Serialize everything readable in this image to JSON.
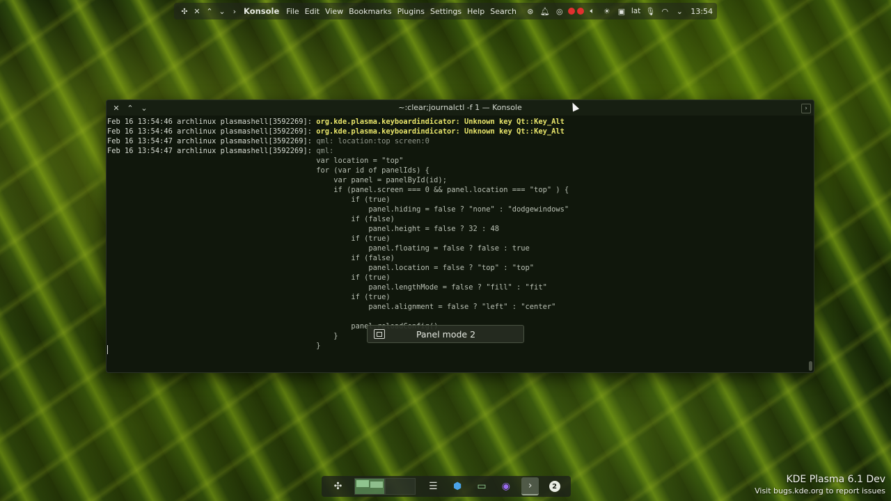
{
  "top_panel": {
    "app_name": "Konsole",
    "menu": [
      "File",
      "Edit",
      "View",
      "Bookmarks",
      "Plugins",
      "Settings",
      "Help",
      "Search"
    ],
    "keyboard_layout": "lat",
    "clock": "13:54"
  },
  "window": {
    "title": "~:clear;journalctl -f 1 — Konsole"
  },
  "terminal": {
    "lines": [
      {
        "prefix": "Feb 16 13:54:46 archlinux plasmashell[3592269]: ",
        "msg": "org.kde.plasma.keyboardindicator: Unknown key Qt::Key_Alt",
        "style": "warn"
      },
      {
        "prefix": "Feb 16 13:54:46 archlinux plasmashell[3592269]: ",
        "msg": "org.kde.plasma.keyboardindicator: Unknown key Qt::Key_Alt",
        "style": "warn"
      },
      {
        "prefix": "Feb 16 13:54:47 archlinux plasmashell[3592269]: ",
        "msg": "qml: location:top screen:0",
        "style": "muted"
      },
      {
        "prefix": "Feb 16 13:54:47 archlinux plasmashell[3592269]: ",
        "msg": "qml:",
        "style": "muted"
      },
      {
        "prefix": "",
        "msg": "                                                var location = \"top\"",
        "style": "code"
      },
      {
        "prefix": "",
        "msg": "                                                for (var id of panelIds) {",
        "style": "code"
      },
      {
        "prefix": "",
        "msg": "                                                    var panel = panelById(id);",
        "style": "code"
      },
      {
        "prefix": "",
        "msg": "                                                    if (panel.screen === 0 && panel.location === \"top\" ) {",
        "style": "code"
      },
      {
        "prefix": "",
        "msg": "                                                        if (true)",
        "style": "code"
      },
      {
        "prefix": "",
        "msg": "                                                            panel.hiding = false ? \"none\" : \"dodgewindows\"",
        "style": "code"
      },
      {
        "prefix": "",
        "msg": "                                                        if (false)",
        "style": "code"
      },
      {
        "prefix": "",
        "msg": "                                                            panel.height = false ? 32 : 48",
        "style": "code"
      },
      {
        "prefix": "",
        "msg": "                                                        if (true)",
        "style": "code"
      },
      {
        "prefix": "",
        "msg": "                                                            panel.floating = false ? false : true",
        "style": "code"
      },
      {
        "prefix": "",
        "msg": "                                                        if (false)",
        "style": "code"
      },
      {
        "prefix": "",
        "msg": "                                                            panel.location = false ? \"top\" : \"top\"",
        "style": "code"
      },
      {
        "prefix": "",
        "msg": "                                                        if (true)",
        "style": "code"
      },
      {
        "prefix": "",
        "msg": "                                                            panel.lengthMode = false ? \"fill\" : \"fit\"",
        "style": "code"
      },
      {
        "prefix": "",
        "msg": "                                                        if (true)",
        "style": "code"
      },
      {
        "prefix": "",
        "msg": "                                                            panel.alignment = false ? \"left\" : \"center\"",
        "style": "code"
      },
      {
        "prefix": "",
        "msg": "",
        "style": "code"
      },
      {
        "prefix": "",
        "msg": "                                                        panel.reloadConfig()",
        "style": "code"
      },
      {
        "prefix": "",
        "msg": "                                                    }",
        "style": "code"
      },
      {
        "prefix": "",
        "msg": "                                                }",
        "style": "code"
      }
    ]
  },
  "osd": {
    "label": "Panel mode 2"
  },
  "dock": {
    "badge": "2"
  },
  "watermark": {
    "title": "KDE Plasma 6.1 Dev",
    "subtitle": "Visit bugs.kde.org to report issues"
  },
  "colors": {
    "warn_text": "#e8e56a",
    "record_red": "#e0302f"
  }
}
